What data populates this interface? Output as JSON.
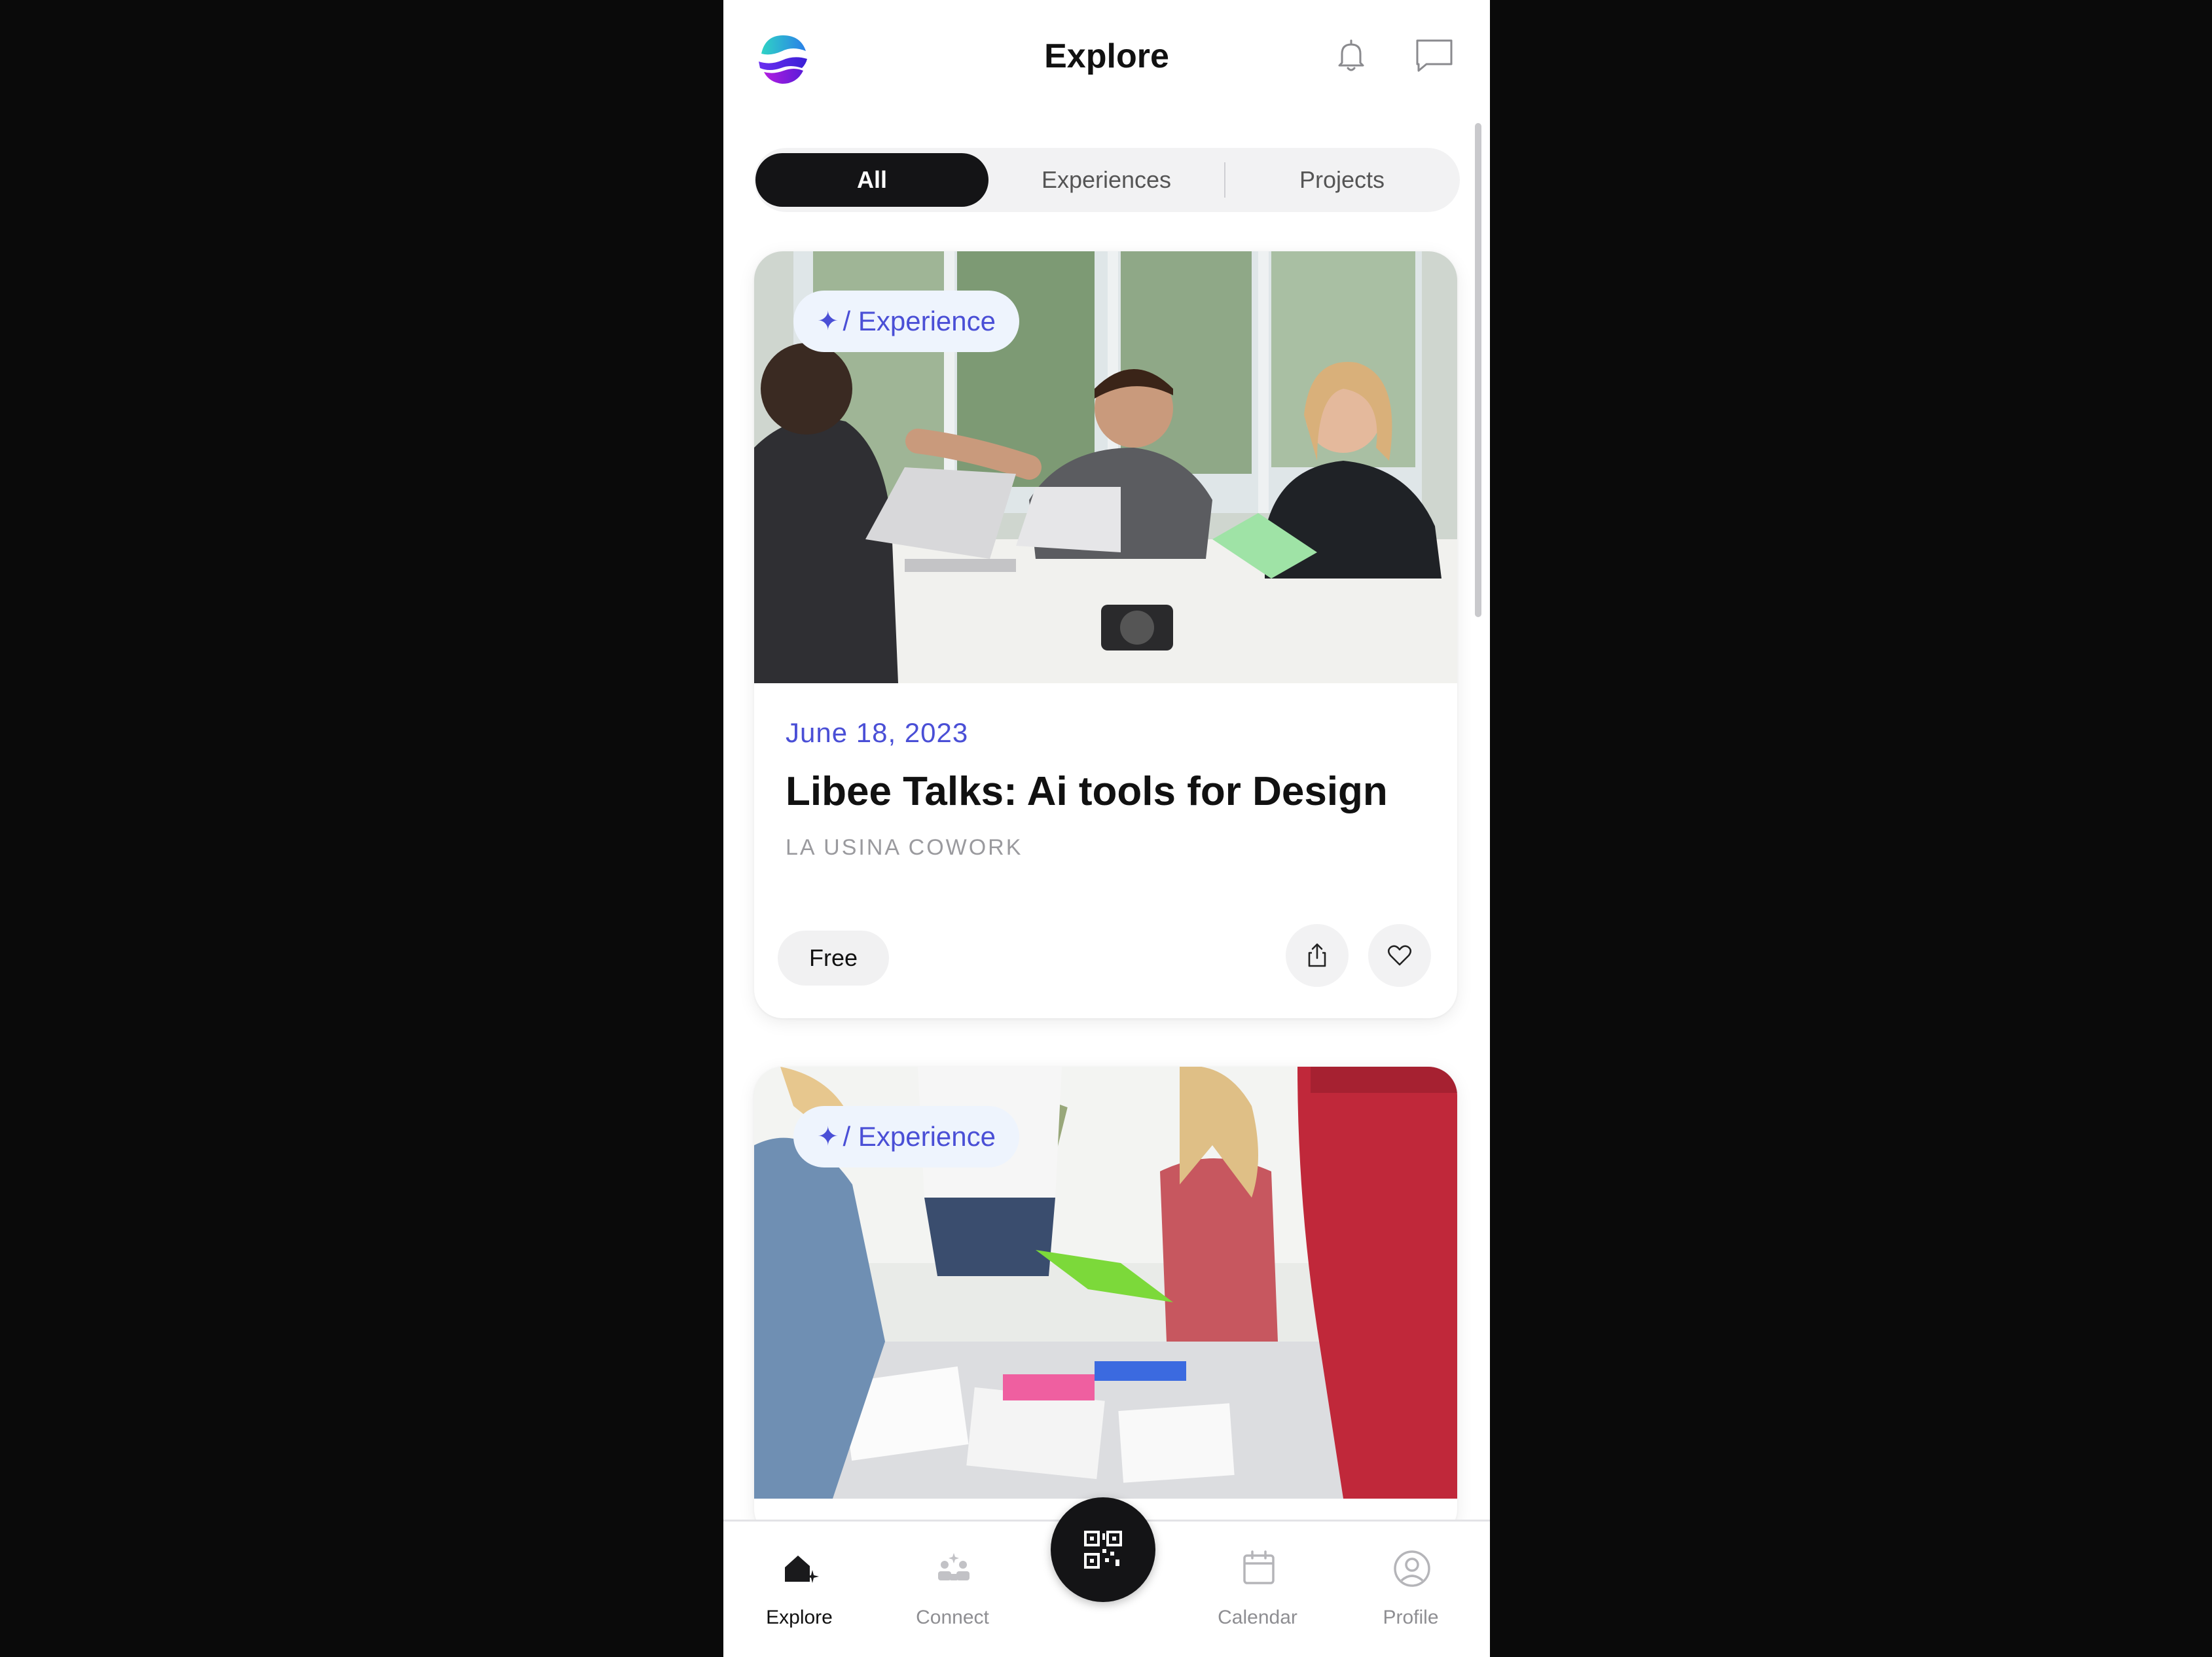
{
  "header": {
    "title": "Explore",
    "logo_icon": "app-logo",
    "notification_icon": "bell-icon",
    "messages_icon": "chat-icon"
  },
  "filters": {
    "tabs": [
      {
        "label": "All",
        "active": true
      },
      {
        "label": "Experiences",
        "active": false
      },
      {
        "label": "Projects",
        "active": false
      }
    ]
  },
  "cards": [
    {
      "tag": "/ Experience",
      "tag_icon": "sparkle-icon",
      "date": "June 18, 2023",
      "title": "Libee Talks: Ai tools for Design",
      "venue": "LA USINA COWORK",
      "price": "Free",
      "image": "team fist bump at office table with laptops"
    },
    {
      "tag": "/ Experience",
      "tag_icon": "sparkle-icon",
      "image": "group reviewing papers around a table"
    }
  ],
  "bottom_nav": {
    "items": [
      {
        "label": "Explore",
        "icon": "home-sparkle-icon",
        "active": true
      },
      {
        "label": "Connect",
        "icon": "people-icon",
        "active": false
      },
      {
        "label": "Calendar",
        "icon": "calendar-icon",
        "active": false
      },
      {
        "label": "Profile",
        "icon": "profile-icon",
        "active": false
      }
    ],
    "fab_icon": "qr-code-icon"
  },
  "colors": {
    "accent": "#4a4fd6",
    "tag_bg": "#eef4fd",
    "active_tab_bg": "#141416",
    "screen_bg": "#0a0a0a"
  }
}
